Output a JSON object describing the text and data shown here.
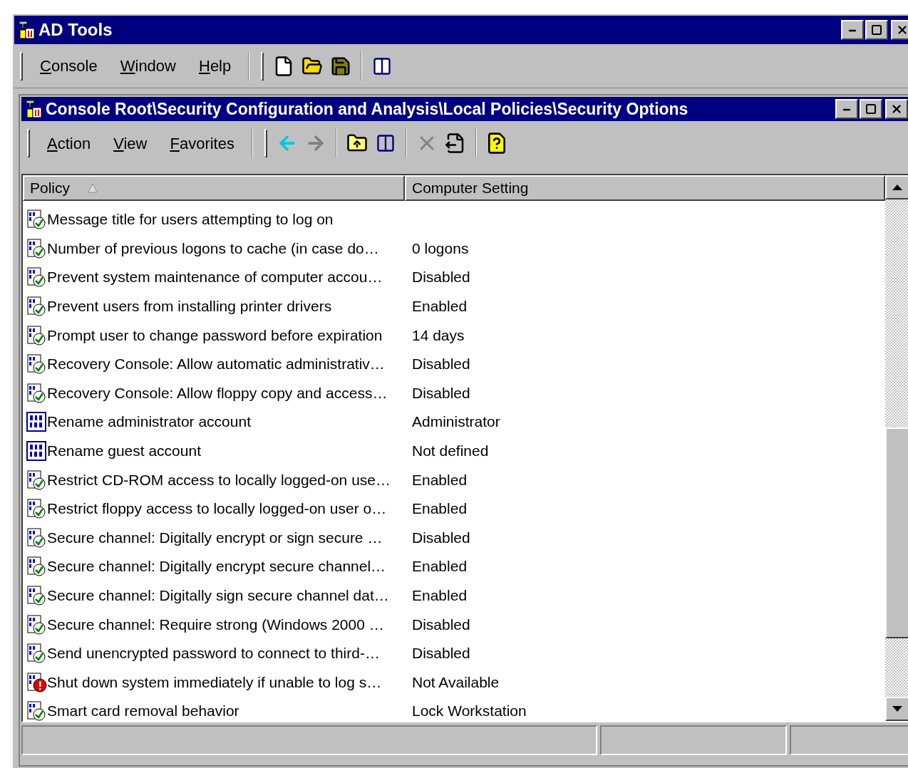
{
  "window": {
    "title": "AD Tools"
  },
  "menu": [
    {
      "label": "Console"
    },
    {
      "label": "Window"
    },
    {
      "label": "Help"
    }
  ],
  "child_window": {
    "title": "Console Root\\Security Configuration and Analysis\\Local Policies\\Security Options"
  },
  "child_menu": [
    {
      "label": "Action"
    },
    {
      "label": "View"
    },
    {
      "label": "Favorites"
    }
  ],
  "table": {
    "columns": [
      {
        "label": "Policy",
        "sorted": true
      },
      {
        "label": "Computer Setting",
        "sorted": false
      }
    ],
    "rows": [
      {
        "kind": "checked",
        "policy": "Message title for users attempting to log on",
        "setting": ""
      },
      {
        "kind": "checked",
        "policy": "Number of previous logons to cache (in case do…",
        "setting": "0 logons"
      },
      {
        "kind": "checked",
        "policy": "Prevent system maintenance of computer accou…",
        "setting": "Disabled"
      },
      {
        "kind": "checked",
        "policy": "Prevent users from installing printer drivers",
        "setting": "Enabled"
      },
      {
        "kind": "checked",
        "policy": "Prompt user to change password before expiration",
        "setting": "14 days"
      },
      {
        "kind": "checked",
        "policy": "Recovery Console: Allow automatic administrativ…",
        "setting": "Disabled"
      },
      {
        "kind": "checked",
        "policy": "Recovery Console: Allow floppy copy and access…",
        "setting": "Disabled"
      },
      {
        "kind": "binary",
        "policy": "Rename administrator account",
        "setting": "Administrator"
      },
      {
        "kind": "binary",
        "policy": "Rename guest account",
        "setting": "Not defined"
      },
      {
        "kind": "checked",
        "policy": "Restrict CD-ROM access to locally logged-on use…",
        "setting": "Enabled"
      },
      {
        "kind": "checked",
        "policy": "Restrict floppy access to locally logged-on user o…",
        "setting": "Enabled"
      },
      {
        "kind": "checked",
        "policy": "Secure channel: Digitally encrypt or sign secure …",
        "setting": "Disabled"
      },
      {
        "kind": "checked",
        "policy": "Secure channel: Digitally encrypt secure channel…",
        "setting": "Enabled"
      },
      {
        "kind": "checked",
        "policy": "Secure channel: Digitally sign secure channel dat…",
        "setting": "Enabled"
      },
      {
        "kind": "checked",
        "policy": "Secure channel: Require strong (Windows 2000 …",
        "setting": "Disabled"
      },
      {
        "kind": "checked",
        "policy": "Send unencrypted password to connect to third-…",
        "setting": "Disabled"
      },
      {
        "kind": "error",
        "policy": "Shut down system immediately if unable to log s…",
        "setting": "Not Available"
      },
      {
        "kind": "checked",
        "policy": "Smart card removal behavior",
        "setting": "Lock Workstation"
      }
    ]
  }
}
